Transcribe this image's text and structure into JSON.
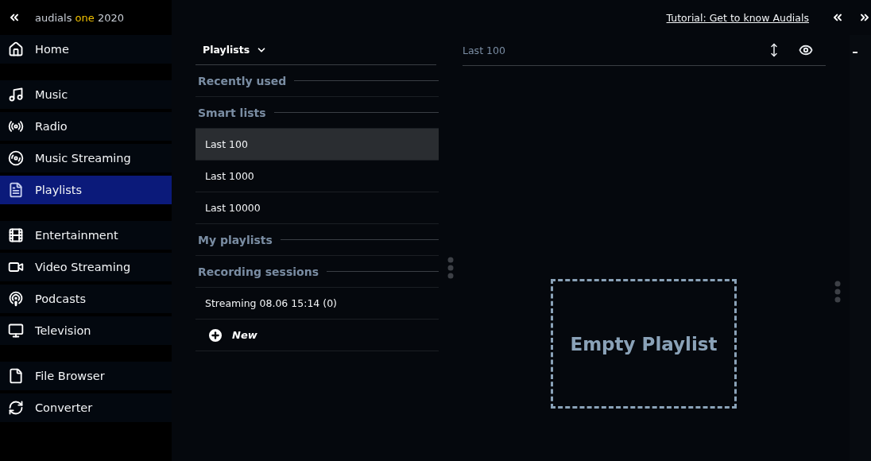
{
  "brand": {
    "name": "audials",
    "edition": "one",
    "year": "2020"
  },
  "sidebar": {
    "groups": [
      {
        "items": [
          {
            "label": "Home",
            "selected": false
          }
        ]
      },
      {
        "items": [
          {
            "label": "Music",
            "selected": false
          },
          {
            "label": "Radio",
            "selected": false
          },
          {
            "label": "Music Streaming",
            "selected": false
          },
          {
            "label": "Playlists",
            "selected": true
          }
        ]
      },
      {
        "items": [
          {
            "label": "Entertainment",
            "selected": false
          },
          {
            "label": "Video Streaming",
            "selected": false
          },
          {
            "label": "Podcasts",
            "selected": false
          },
          {
            "label": "Television",
            "selected": false
          }
        ]
      },
      {
        "items": [
          {
            "label": "File Browser",
            "selected": false
          },
          {
            "label": "Converter",
            "selected": false
          }
        ]
      }
    ]
  },
  "top_bar": {
    "tutorial_link": "Tutorial: Get to know Audials"
  },
  "playlist_panel": {
    "dropdown": "Playlists",
    "rows": [
      {
        "kind": "header",
        "label": "Recently used"
      },
      {
        "kind": "header",
        "label": "Smart lists"
      },
      {
        "kind": "item",
        "label": "Last 100",
        "selected": true
      },
      {
        "kind": "item",
        "label": "Last 1000",
        "selected": false
      },
      {
        "kind": "item",
        "label": "Last 10000",
        "selected": false
      },
      {
        "kind": "header",
        "label": "My playlists"
      },
      {
        "kind": "header",
        "label": "Recording sessions"
      },
      {
        "kind": "item",
        "label": "Streaming 08.06 15:14 (0)",
        "selected": false
      },
      {
        "kind": "new",
        "label": "New"
      }
    ]
  },
  "content_panel": {
    "title": "Last 100",
    "empty_message": "Empty Playlist"
  }
}
